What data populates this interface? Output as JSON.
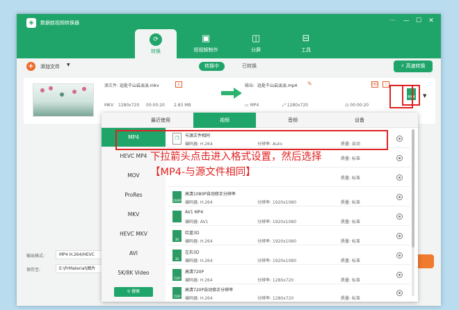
{
  "app": {
    "title": "数据蛙视频转换器"
  },
  "window_controls": [
    "⋯",
    "—",
    "☐",
    "✕"
  ],
  "nav_tabs": [
    {
      "label": "转换"
    },
    {
      "label": "短视频制作"
    },
    {
      "label": "分屏"
    },
    {
      "label": "工具"
    }
  ],
  "toolbar": {
    "add_file": "添加文件",
    "converting": "转换中",
    "converted": "已转换",
    "hs_button": "高速转换"
  },
  "file": {
    "source_label": "源文件:",
    "source_name": "远处千山云淡淡.mkv",
    "output_label": "输出:",
    "output_name": "远处千山云淡淡.mp4",
    "src_format": "MKV",
    "src_resolution": "1280x720",
    "src_duration": "00:00:20",
    "src_size": "2.83 MB",
    "out_format": "MP4",
    "out_resolution": "1280x720",
    "out_duration": "00:00:20",
    "format_icon": "MP4"
  },
  "bottom": {
    "output_format_label": "输出格式:",
    "output_format_value": "MP4 H.264/HEVC",
    "save_label": "保存至:",
    "save_value": "E:\\PrMaterial\\图片"
  },
  "panel": {
    "tabs": [
      "最近使用",
      "视频",
      "音频",
      "设备"
    ],
    "sidebar": [
      "MP4",
      "HEVC MP4",
      "MOV",
      "ProRes",
      "MKV",
      "HEVC MKV",
      "AVI",
      "5K/8K Video"
    ],
    "search": "搜索",
    "rows": [
      {
        "icon": "",
        "name": "与源文件相同",
        "encoder": "编码器: H.264",
        "resolution": "分辨率: Auto",
        "quality": "质量: 自动"
      },
      {
        "icon": "",
        "name": "",
        "encoder": "",
        "resolution": "",
        "quality": "质量: 标准"
      },
      {
        "icon": "",
        "name": "",
        "encoder": "",
        "resolution": "",
        "quality": "质量: 标准"
      },
      {
        "icon": "1080P",
        "name": "高清1080P自动修正分辨率",
        "encoder": "编码器: H.264",
        "resolution": "分辨率: 1920x1080",
        "quality": "质量: 标准"
      },
      {
        "icon": "",
        "name": "AV1 MP4",
        "encoder": "编码器: AV1",
        "resolution": "分辨率: 1920x1080",
        "quality": "质量: 标准"
      },
      {
        "icon": "3D",
        "name": "红蓝3D",
        "encoder": "编码器: H.264",
        "resolution": "分辨率: 1920x1080",
        "quality": "质量: 标准"
      },
      {
        "icon": "3D",
        "name": "左右3D",
        "encoder": "编码器: H.264",
        "resolution": "分辨率: 1920x1080",
        "quality": "质量: 标准"
      },
      {
        "icon": "720P",
        "name": "高清720P",
        "encoder": "编码器: H.264",
        "resolution": "分辨率: 1280x720",
        "quality": "质量: 标准"
      },
      {
        "icon": "720P",
        "name": "高清720P自动修正分辨率",
        "encoder": "编码器: H.264",
        "resolution": "分辨率: 1280x720",
        "quality": "质量: 标准"
      }
    ]
  },
  "annotation": "下拉箭头点击进入格式设置，然后选择【MP4-与源文件相同】",
  "colors": {
    "brand": "#1fa56a",
    "highlight": "#e02020",
    "accent": "#ec6b2c"
  }
}
